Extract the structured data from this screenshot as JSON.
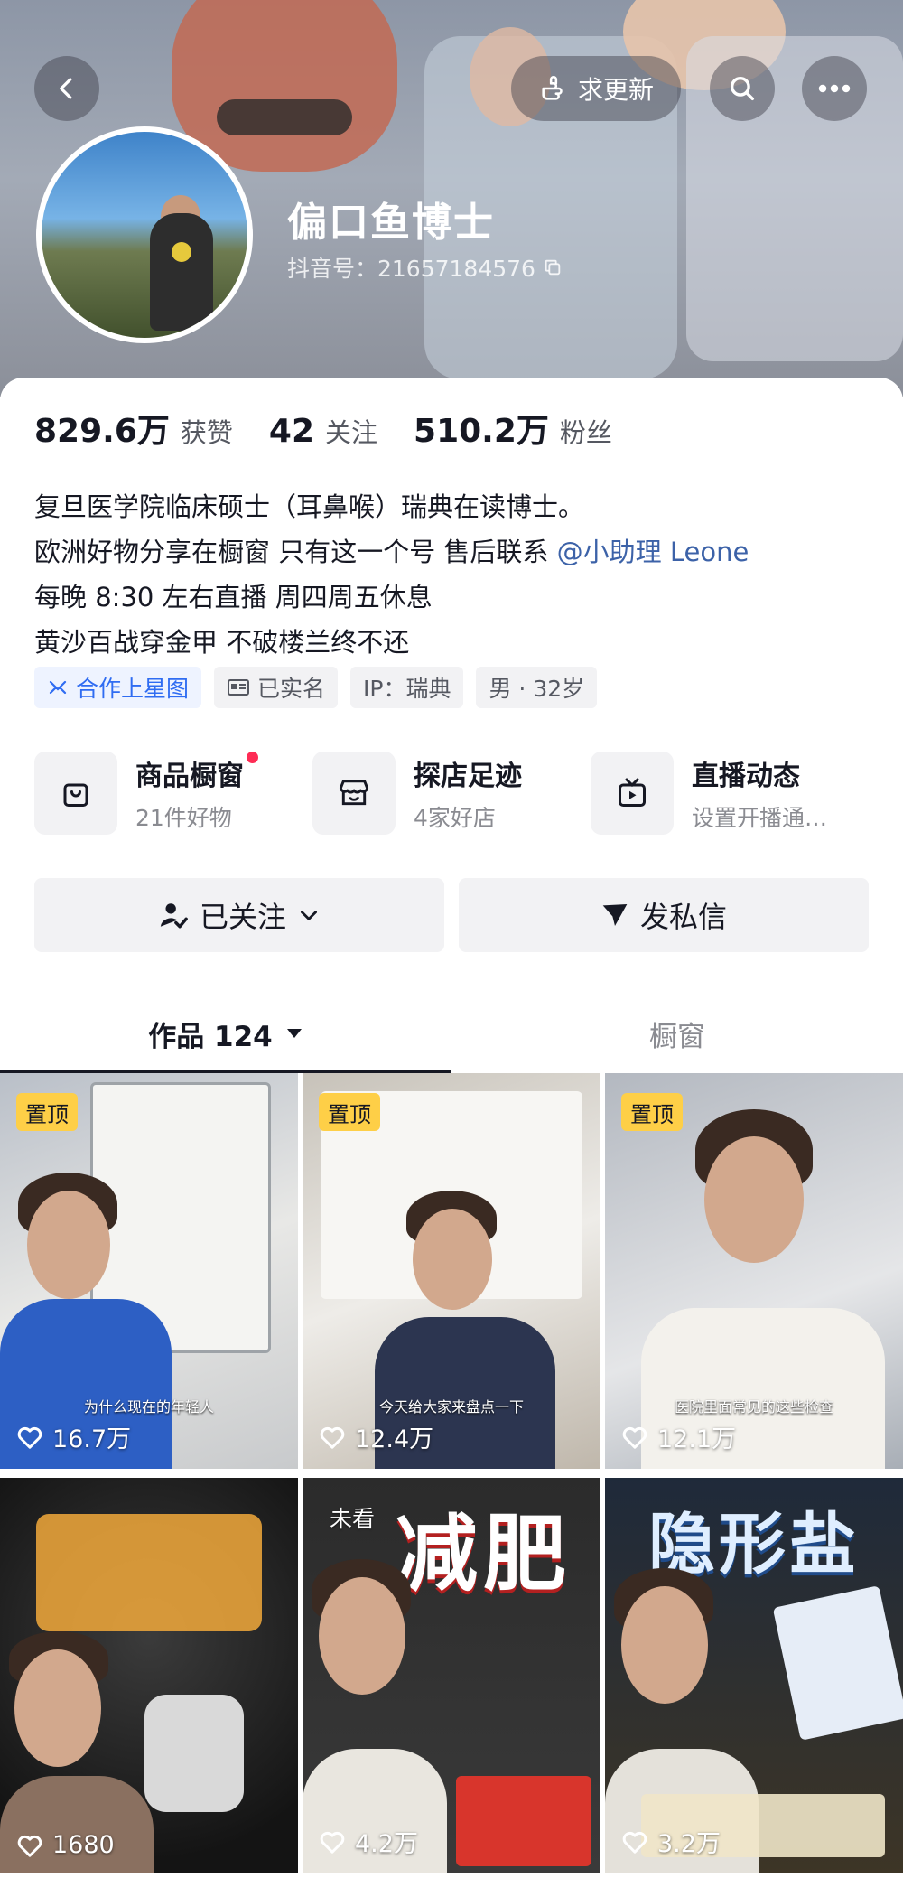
{
  "header": {
    "update_label": "求更新",
    "nickname": "偏口鱼博士",
    "douyin_id": "抖音号：21657184576"
  },
  "stats": [
    {
      "value": "829.6万",
      "label": "获赞"
    },
    {
      "value": "42",
      "label": "关注"
    },
    {
      "value": "510.2万",
      "label": "粉丝"
    }
  ],
  "bio": {
    "line1": "复旦医学院临床硕士（耳鼻喉）瑞典在读博士。",
    "line2_prefix": "欧洲好物分享在橱窗 只有这一个号 售后联系",
    "line2_mention": "@小助理 Leone",
    "line3": "每晚 8:30 左右直播 周四周五休息",
    "line4": "黄沙百战穿金甲 不破楼兰终不还"
  },
  "tags": [
    {
      "label": "合作上星图",
      "icon": "star-map-icon"
    },
    {
      "label": "已实名",
      "icon": "id-card-icon"
    },
    {
      "label": "IP：瑞典",
      "icon": ""
    },
    {
      "label": "男 · 32岁",
      "icon": ""
    }
  ],
  "shortcuts": [
    {
      "title": "商品橱窗",
      "sub": "21件好物",
      "icon": "shopping-bag-icon",
      "badge": true
    },
    {
      "title": "探店足迹",
      "sub": "4家好店",
      "icon": "store-icon",
      "badge": false
    },
    {
      "title": "直播动态",
      "sub": "设置开播通…",
      "icon": "tv-icon",
      "badge": false
    }
  ],
  "actions": {
    "following_label": "已关注",
    "message_label": "发私信"
  },
  "tabs": {
    "works_label": "作品 124",
    "showcase_label": "橱窗"
  },
  "videos": [
    {
      "pinned_label": "置顶",
      "likes": "16.7万",
      "subtitle": "为什么现在的年轻人"
    },
    {
      "pinned_label": "置顶",
      "likes": "12.4万",
      "subtitle": "今天给大家来盘点一下"
    },
    {
      "pinned_label": "置顶",
      "likes": "12.1万",
      "subtitle": "医院里面常见的这些检查"
    },
    {
      "likes": "1680"
    },
    {
      "unseen_label": "未看",
      "likes": "4.2万",
      "headline": "减肥"
    },
    {
      "likes": "3.2万",
      "headline": "隐形盐"
    }
  ],
  "colors": {
    "accent_red": "#fe2c55",
    "pin_yellow": "#fecf47",
    "mention_blue": "#3c62a8"
  }
}
